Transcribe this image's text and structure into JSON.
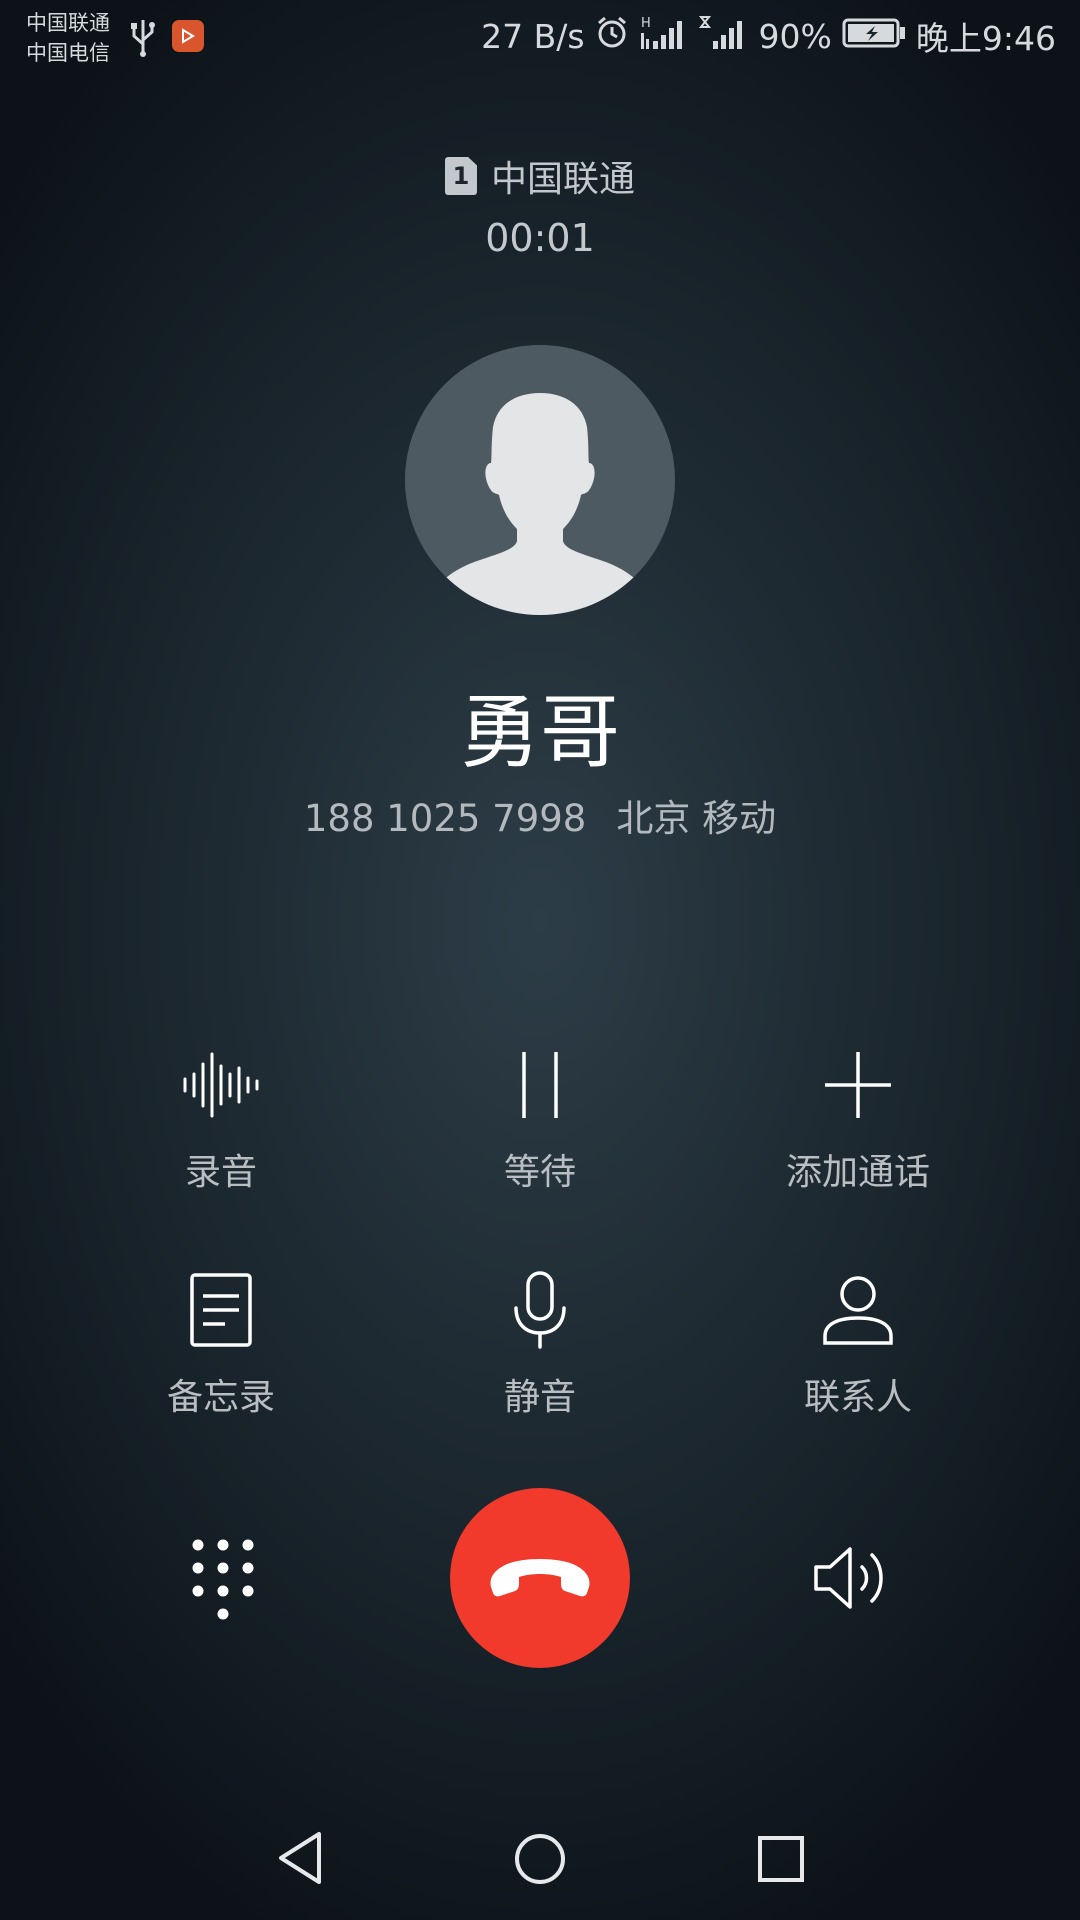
{
  "status_bar": {
    "carrier_1": "中国联通",
    "carrier_2": "中国电信",
    "net_speed": "27 B/s",
    "signal_1_tag": "H",
    "battery": "90%",
    "time": "晚上9:46"
  },
  "call": {
    "sim_number": "1",
    "sim_carrier": "中国联通",
    "duration": "00:01",
    "contact_name": "勇哥",
    "phone_number": "188 1025 7998",
    "location": "北京 移动"
  },
  "actions": {
    "record": "录音",
    "hold": "等待",
    "add_call": "添加通话",
    "notes": "备忘录",
    "mute": "静音",
    "contacts": "联系人"
  },
  "colors": {
    "hangup": "#f13a2c",
    "background": "#1e2a32",
    "text_secondary": "#b9bec2"
  }
}
